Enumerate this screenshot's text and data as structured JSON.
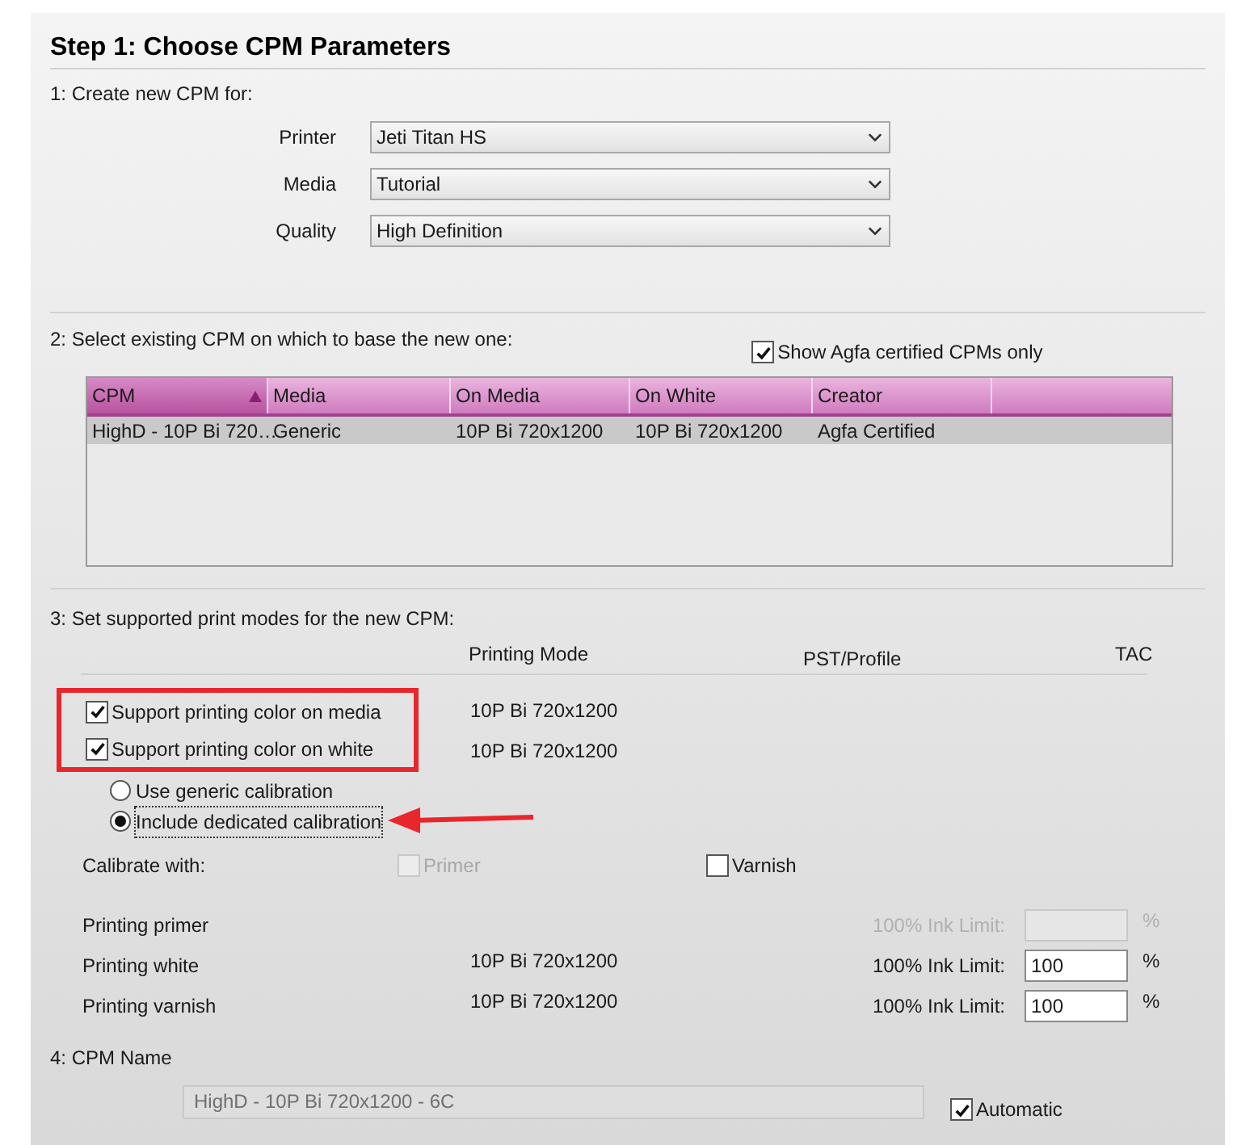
{
  "title": "Step 1: Choose CPM Parameters",
  "section1": {
    "label": "1: Create new CPM for:",
    "fields": [
      {
        "label": "Printer",
        "value": "Jeti Titan HS"
      },
      {
        "label": "Media",
        "value": "Tutorial"
      },
      {
        "label": "Quality",
        "value": "High Definition"
      }
    ]
  },
  "section2": {
    "label": "2: Select existing CPM on which to base the new one:",
    "certified_only": {
      "label": "Show Agfa certified CPMs only",
      "checked": true
    },
    "table": {
      "columns": [
        {
          "label": "CPM",
          "sorted": true
        },
        {
          "label": "Media",
          "sorted": false
        },
        {
          "label": "On Media",
          "sorted": false
        },
        {
          "label": "On White",
          "sorted": false
        },
        {
          "label": "Creator",
          "sorted": false
        }
      ],
      "rows": [
        {
          "cells": [
            "HighD - 10P Bi 720…",
            "Generic",
            "10P Bi 720x1200",
            "10P Bi 720x1200",
            "Agfa Certified"
          ],
          "selected": true
        }
      ]
    }
  },
  "section3": {
    "label": "3: Set supported print modes for the new CPM:",
    "columns": [
      "Printing Mode",
      "PST/Profile",
      "TAC"
    ],
    "options": [
      {
        "label": "Support printing color on media",
        "checked": true,
        "mode": "10P Bi 720x1200"
      },
      {
        "label": "Support printing color on white",
        "checked": true,
        "mode": "10P Bi 720x1200"
      }
    ],
    "calibration": [
      {
        "label": "Use generic calibration",
        "selected": false
      },
      {
        "label": "Include dedicated calibration",
        "selected": true
      }
    ],
    "calibrate_with": {
      "label": "Calibrate with:",
      "options": [
        {
          "label": "Primer",
          "checked": false,
          "disabled": true
        },
        {
          "label": "Varnish",
          "checked": false,
          "disabled": false
        }
      ]
    },
    "inks": [
      {
        "name": "Printing primer",
        "limit_label": "100% Ink Limit:",
        "unit": "%",
        "disabled": true
      },
      {
        "name": "Printing white",
        "mode": "10P Bi 720x1200",
        "limit_label": "100% Ink Limit:",
        "value": "100",
        "unit": "%",
        "disabled": false
      },
      {
        "name": "Printing varnish",
        "mode": "10P Bi 720x1200",
        "limit_label": "100% Ink Limit:",
        "value": "100",
        "unit": "%",
        "disabled": false
      }
    ]
  },
  "section4": {
    "label": "4: CPM Name",
    "name": {
      "value": "HighD - 10P Bi 720x1200 - 6C",
      "disabled": true
    },
    "automatic": {
      "label": "Automatic",
      "checked": true
    }
  }
}
